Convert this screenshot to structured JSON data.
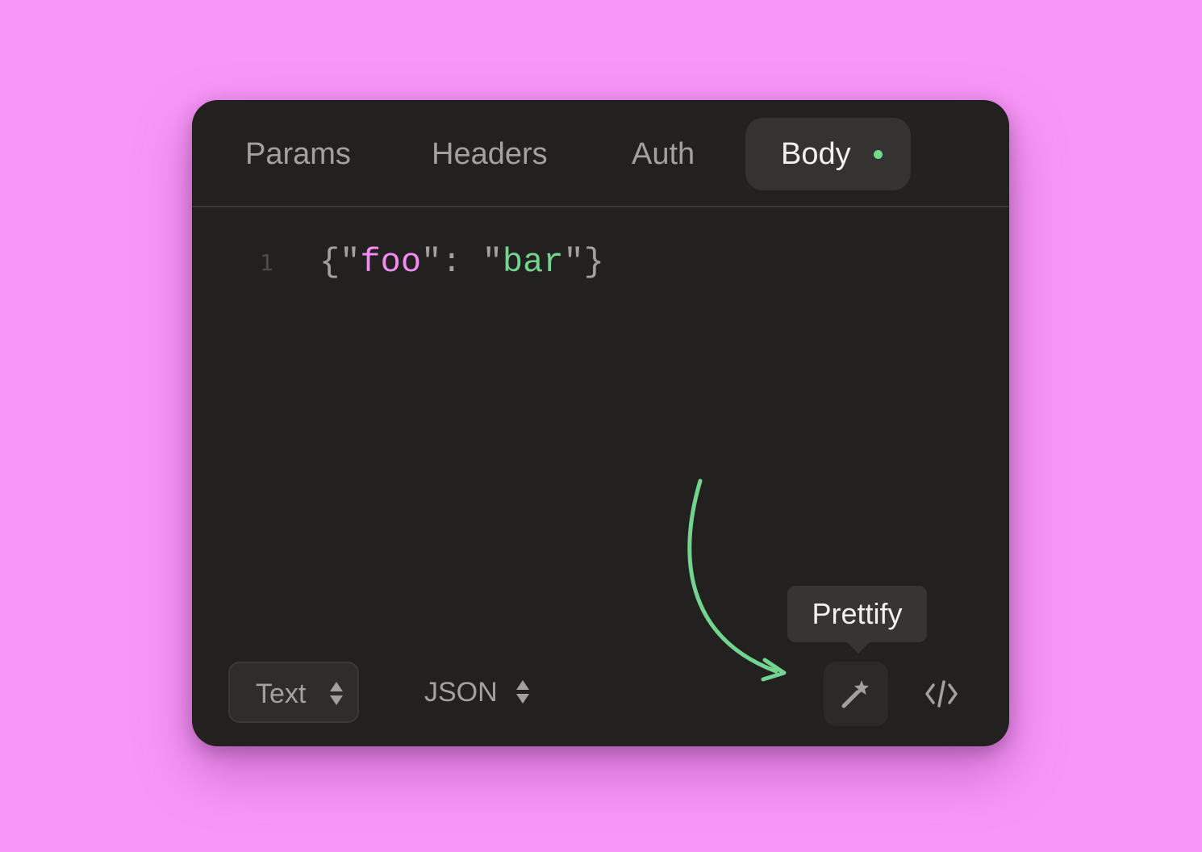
{
  "tabs": [
    {
      "label": "Params",
      "active": false
    },
    {
      "label": "Headers",
      "active": false
    },
    {
      "label": "Auth",
      "active": false
    },
    {
      "label": "Body",
      "active": true,
      "has_indicator": true
    }
  ],
  "editor": {
    "line_numbers": [
      "1"
    ],
    "code": {
      "open_brace": "{",
      "key_quote_open": "\"",
      "key": "foo",
      "key_quote_close": "\"",
      "colon": ": ",
      "value_quote_open": "\"",
      "value": "bar",
      "value_quote_close": "\"",
      "close_brace": "}"
    }
  },
  "toolbar": {
    "text_mode_label": "Text",
    "format_label": "JSON",
    "prettify_icon": "magic-wand-icon",
    "code_icon": "code-brackets-icon"
  },
  "tooltip": {
    "label": "Prettify"
  },
  "colors": {
    "background": "#f897f9",
    "panel": "#232120",
    "active_tab": "#353331",
    "indicator": "#6fdc8c",
    "json_key": "#f58af5",
    "json_string": "#72d48f",
    "muted_text": "#a3a09d",
    "annotation_arrow": "#72d48f"
  }
}
